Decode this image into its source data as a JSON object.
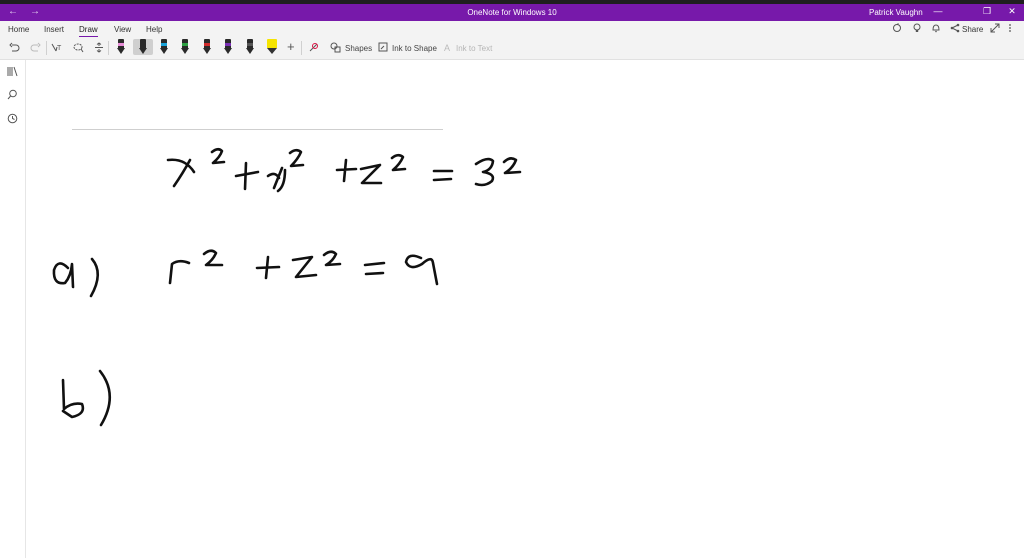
{
  "window": {
    "title": "OneNote for Windows 10",
    "user": "Patrick Vaughn",
    "back_glyph": "←",
    "forward_glyph": "→",
    "minimize_glyph": "—",
    "restore_glyph": "❐",
    "close_glyph": "✕"
  },
  "menu": {
    "tabs": [
      "Home",
      "Insert",
      "Draw",
      "View",
      "Help"
    ],
    "active_tab": "Draw",
    "share_label": "Share"
  },
  "ribbon": {
    "shapes_label": "Shapes",
    "ink_to_shape_label": "Ink to Shape",
    "ink_to_text_label": "Ink to Text",
    "pens": [
      {
        "name": "pen-black-pink",
        "band": "#e78bd6"
      },
      {
        "name": "pen-black-selected",
        "band": "#1a1a1a"
      },
      {
        "name": "pen-cyan",
        "band": "#1aa3d9"
      },
      {
        "name": "pen-green",
        "band": "#2ea043"
      },
      {
        "name": "pen-red",
        "band": "#d12b2b"
      },
      {
        "name": "pen-purple",
        "band": "#7a2fb5"
      },
      {
        "name": "pen-dark",
        "band": "#333333"
      },
      {
        "name": "highlighter-yellow",
        "band": "#f5e400"
      }
    ]
  },
  "colors": {
    "accent": "#7719aa",
    "ink": "#111111"
  },
  "notes": {
    "line1": "x² + y² + z² = 3²",
    "line2_label": "a)",
    "line2": "r² + z² = 9",
    "line3_label": "b)"
  }
}
